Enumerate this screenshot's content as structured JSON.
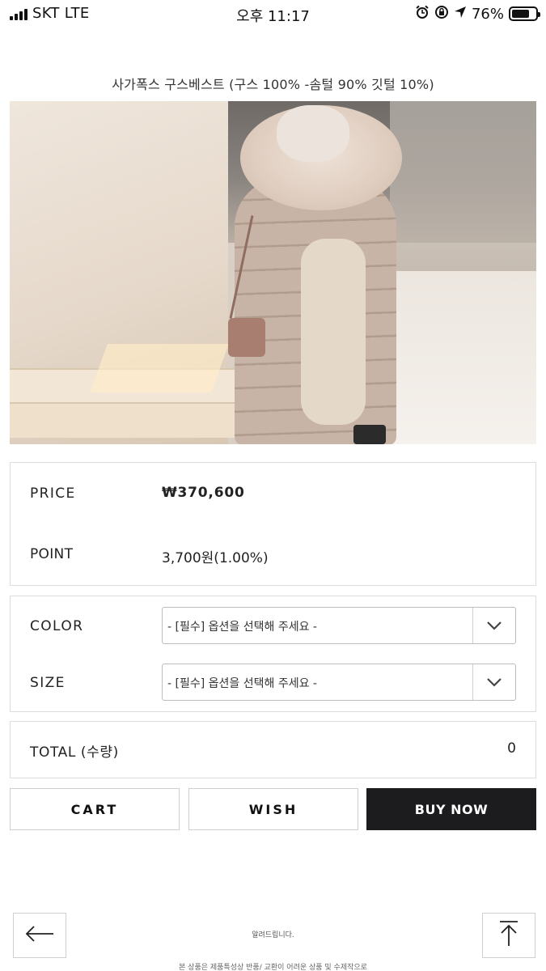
{
  "status_bar": {
    "carrier": "SKT LTE",
    "time": "오후 11:17",
    "battery_percent": "76%",
    "battery_level": 0.76,
    "icons": [
      "signal-icon",
      "alarm-icon",
      "rotation-lock-icon",
      "location-icon",
      "battery-icon"
    ]
  },
  "product": {
    "title": "사가폭스 구스베스트 (구스 100% -솜털 90% 깃털 10%)",
    "image_alt": "product-photo"
  },
  "pricing": {
    "price_label": "PRICE",
    "price_value": "₩370,600",
    "point_label": "POINT",
    "point_value": "3,700원(1.00%)"
  },
  "options": {
    "color_label": "COLOR",
    "color_selected": "- [필수] 옵션을 선택해 주세요 -",
    "size_label": "SIZE",
    "size_selected": "- [필수] 옵션을 선택해 주세요 -"
  },
  "total": {
    "label": "TOTAL (수량)",
    "value": "0"
  },
  "actions": {
    "cart_label": "CART",
    "wish_label": "WISH",
    "buy_label": "BUY NOW"
  },
  "footer": {
    "notice_title": "알려드립니다.",
    "notice_text": "본 상품은 제품특성상 반품/ 교환이 어려운 상품 및 수제작으로"
  },
  "colors": {
    "buy_button_bg": "#1c1c1e",
    "border": "#dcdcdc",
    "text": "#222222"
  }
}
